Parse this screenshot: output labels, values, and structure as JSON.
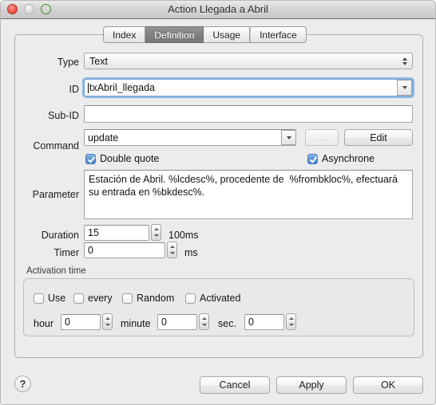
{
  "window": {
    "title": "Action Llegada a Abril",
    "controls": {
      "close": "close-button",
      "minimize": "minimize-button",
      "zoom": "zoom-button"
    }
  },
  "tabs": [
    {
      "label": "Index",
      "selected": false
    },
    {
      "label": "Definition",
      "selected": true
    },
    {
      "label": "Usage",
      "selected": false
    },
    {
      "label": "Interface",
      "selected": false
    }
  ],
  "form": {
    "type": {
      "label": "Type",
      "value": "Text"
    },
    "id": {
      "label": "ID",
      "value": "txAbril_llegada",
      "focused": true
    },
    "subid": {
      "label": "Sub-ID",
      "value": "",
      "placeholder": ""
    },
    "command": {
      "label": "Command",
      "value": "update",
      "browse_label": "...",
      "edit_label": "Edit"
    },
    "double_quote": {
      "label": "Double quote",
      "checked": true
    },
    "asynchrone": {
      "label": "Asynchrone",
      "checked": true
    },
    "parameter": {
      "label": "Parameter",
      "value": "Estación de Abril. %lcdesc%, procedente de  %frombkloc%, efectuará su entrada en %bkdesc%."
    },
    "duration": {
      "label": "Duration",
      "value": "15",
      "unit": "100ms"
    },
    "timer": {
      "label": "Timer",
      "value": "0",
      "unit": "ms"
    }
  },
  "activation": {
    "title": "Activation time",
    "checkboxes": [
      {
        "label": "Use",
        "checked": false
      },
      {
        "label": "every",
        "checked": false
      },
      {
        "label": "Random",
        "checked": false
      },
      {
        "label": "Activated",
        "checked": false
      }
    ],
    "hour": {
      "label": "hour",
      "value": "0"
    },
    "minute": {
      "label": "minute",
      "value": "0"
    },
    "sec": {
      "label": "sec.",
      "value": "0"
    }
  },
  "footer": {
    "help_label": "?",
    "cancel_label": "Cancel",
    "apply_label": "Apply",
    "ok_label": "OK"
  },
  "colors": {
    "window_bg": "#ececec",
    "accent_checkbox": "#5d93d4",
    "focus_ring": "#6ea5e0",
    "tab_selected_bg": "#818181"
  }
}
